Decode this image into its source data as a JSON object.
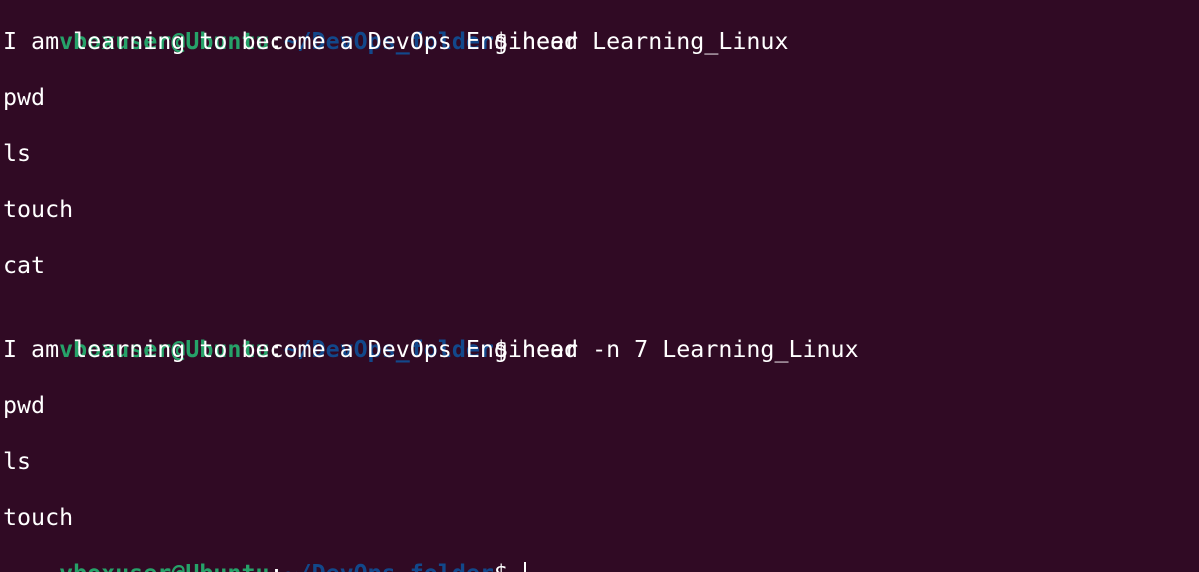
{
  "colors": {
    "background": "#300a24",
    "user_host": "#26a269",
    "path": "#12488b",
    "text": "#ffffff"
  },
  "prompt": {
    "user_host": "vboxuser@Ubuntu",
    "colon": ":",
    "path": "~/DevOps_folder",
    "dollar": "$"
  },
  "session": {
    "cmd1": " head Learning_Linux",
    "out1": {
      "l1": "I am learning to become a DevOps Engineer",
      "l3": "pwd",
      "l5": "ls",
      "l7": "touch",
      "l9": "cat"
    },
    "cmd2": " head -n 7 Learning_Linux",
    "out2": {
      "l1": "I am learning to become a DevOps Engineer",
      "l3": "pwd",
      "l5": "ls",
      "l7": "touch"
    },
    "cmd3": " "
  }
}
